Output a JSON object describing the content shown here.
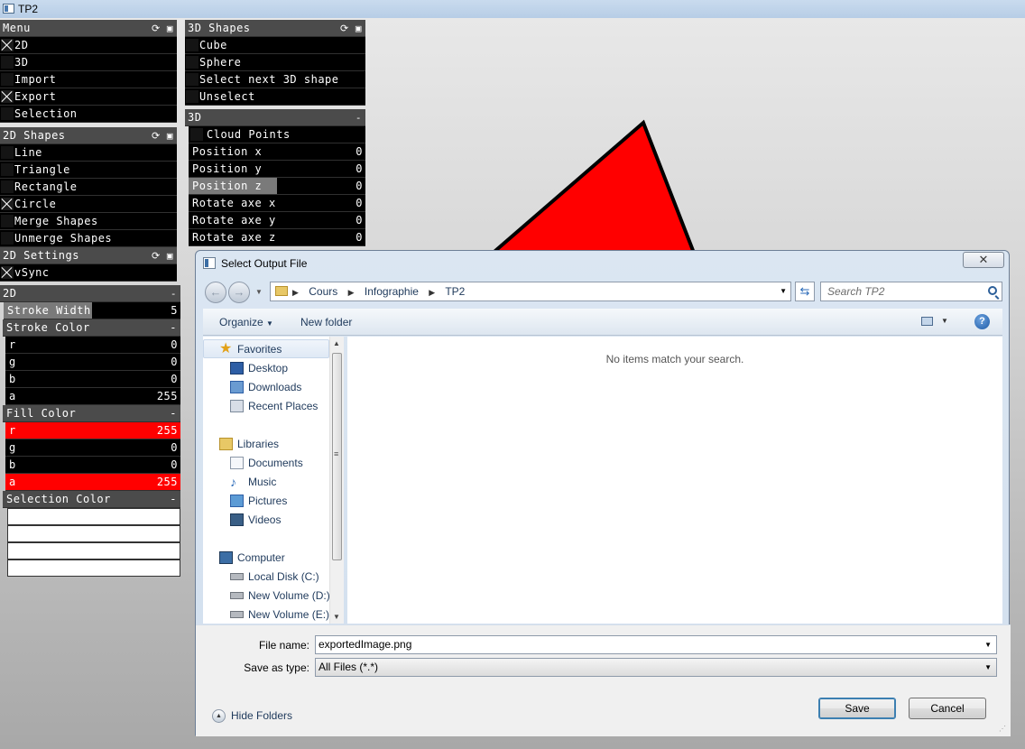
{
  "window": {
    "title": "TP2"
  },
  "menu_panel": {
    "title": "Menu",
    "items": [
      {
        "label": "2D",
        "checked": true
      },
      {
        "label": "3D",
        "checked": false
      },
      {
        "label": "Import",
        "checked": false
      },
      {
        "label": "Export",
        "checked": true
      },
      {
        "label": "Selection",
        "checked": false
      }
    ]
  },
  "shapes2d_panel": {
    "title": "2D Shapes",
    "items": [
      {
        "label": "Line",
        "checked": false
      },
      {
        "label": "Triangle",
        "checked": false
      },
      {
        "label": "Rectangle",
        "checked": false
      },
      {
        "label": "Circle",
        "checked": true
      },
      {
        "label": "Merge Shapes",
        "checked": false
      },
      {
        "label": "Unmerge Shapes",
        "checked": false
      }
    ]
  },
  "settings2d_panel": {
    "title": "2D Settings",
    "items": [
      {
        "label": "vSync",
        "checked": true
      }
    ]
  },
  "panel2d": {
    "title": "2D",
    "collapse": "-",
    "stroke_width": {
      "label": "Stroke Width",
      "value": "5"
    },
    "stroke_color": {
      "title": "Stroke Color",
      "collapse": "-",
      "channels": [
        {
          "label": "r",
          "value": "0"
        },
        {
          "label": "g",
          "value": "0"
        },
        {
          "label": "b",
          "value": "0"
        },
        {
          "label": "a",
          "value": "255"
        }
      ]
    },
    "fill_color": {
      "title": "Fill Color",
      "collapse": "-",
      "channels": [
        {
          "label": "r",
          "value": "255"
        },
        {
          "label": "g",
          "value": "0"
        },
        {
          "label": "b",
          "value": "0"
        },
        {
          "label": "a",
          "value": "255"
        }
      ]
    },
    "selection_color": {
      "title": "Selection Color",
      "collapse": "-"
    }
  },
  "shapes3d_panel": {
    "title": "3D Shapes",
    "items": [
      {
        "label": "Cube",
        "checked": false
      },
      {
        "label": "Sphere",
        "checked": false
      },
      {
        "label": "Select next 3D shape",
        "checked": false
      },
      {
        "label": "Unselect",
        "checked": false
      }
    ]
  },
  "panel3d": {
    "title": "3D",
    "collapse": "-",
    "cloud_points": {
      "label": "Cloud Points",
      "checked": false
    },
    "sliders": [
      {
        "label": "Position x",
        "value": "0"
      },
      {
        "label": "Position y",
        "value": "0"
      },
      {
        "label": "Position z",
        "value": "0",
        "highlighted": true
      },
      {
        "label": "Rotate axe x",
        "value": "0"
      },
      {
        "label": "Rotate axe y",
        "value": "0"
      },
      {
        "label": "Rotate axe z",
        "value": "0"
      }
    ]
  },
  "icons": {
    "reset": "refresh-icon",
    "save": "floppy-icon"
  },
  "colors": {
    "fill": "#ff0000",
    "stroke": "#000000",
    "gui_bg": "#000000",
    "gui_header": "#4b4b4b"
  },
  "dialog": {
    "title": "Select Output File",
    "close": "✕",
    "breadcrumb": [
      "Cours",
      "Infographie",
      "TP2"
    ],
    "search_placeholder": "Search TP2",
    "organize": "Organize",
    "new_folder": "New folder",
    "help": "?",
    "nav": [
      {
        "label": "Favorites",
        "icon": "star-icon"
      },
      {
        "label": "Desktop",
        "icon": "desktop-icon"
      },
      {
        "label": "Downloads",
        "icon": "downloads-icon"
      },
      {
        "label": "Recent Places",
        "icon": "recent-places-icon"
      },
      {
        "label": "Libraries",
        "icon": "libraries-icon"
      },
      {
        "label": "Documents",
        "icon": "documents-icon"
      },
      {
        "label": "Music",
        "icon": "music-icon"
      },
      {
        "label": "Pictures",
        "icon": "pictures-icon"
      },
      {
        "label": "Videos",
        "icon": "videos-icon"
      },
      {
        "label": "Computer",
        "icon": "computer-icon"
      },
      {
        "label": "Local Disk (C:)",
        "icon": "disk-icon"
      },
      {
        "label": "New Volume (D:)",
        "icon": "disk-icon"
      },
      {
        "label": "New Volume (E:)",
        "icon": "disk-icon"
      }
    ],
    "empty_message": "No items match your search.",
    "file_name_label": "File name:",
    "file_name_value": "exportedImage.png",
    "save_type_label": "Save as type:",
    "save_type_value": "All Files (*.*)",
    "hide_folders": "Hide Folders",
    "save_button": "Save",
    "cancel_button": "Cancel"
  }
}
